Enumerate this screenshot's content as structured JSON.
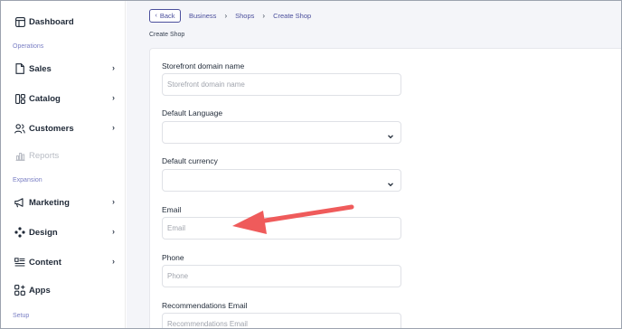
{
  "sidebar": {
    "dashboard": "Dashboard",
    "sections": {
      "operations": "Operations",
      "expansion": "Expansion",
      "setup": "Setup"
    },
    "items": {
      "sales": "Sales",
      "catalog": "Catalog",
      "customers": "Customers",
      "reports": "Reports",
      "marketing": "Marketing",
      "design": "Design",
      "content": "Content",
      "apps": "Apps"
    }
  },
  "topbar": {
    "back_label": "Back",
    "breadcrumbs": [
      "Business",
      "Shops",
      "Create Shop"
    ]
  },
  "page": {
    "title": "Create Shop"
  },
  "form": {
    "storefront": {
      "label": "Storefront domain name",
      "placeholder": "Storefront domain name"
    },
    "language": {
      "label": "Default Language",
      "value": ""
    },
    "currency": {
      "label": "Default currency",
      "value": ""
    },
    "email": {
      "label": "Email",
      "placeholder": "Email"
    },
    "phone": {
      "label": "Phone",
      "placeholder": "Phone"
    },
    "rec_email": {
      "label": "Recommendations Email",
      "placeholder": "Recommendations Email"
    }
  },
  "annotation": {
    "arrow_color": "#ef5b5b"
  },
  "colors": {
    "accent": "#4b4f9c",
    "section_label": "#7a7fc4"
  }
}
